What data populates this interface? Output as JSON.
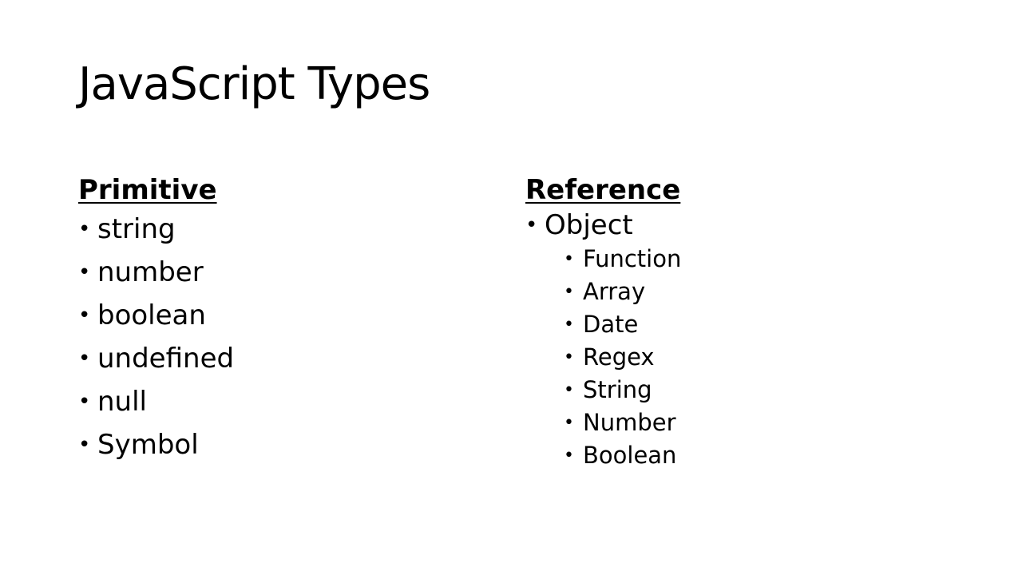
{
  "slide": {
    "title": "JavaScript Types",
    "primitive": {
      "heading": "Primitive",
      "items": [
        "string",
        "number",
        "boolean",
        "undefined",
        "null",
        "Symbol"
      ]
    },
    "reference": {
      "heading": "Reference",
      "item": "Object",
      "subitems": [
        "Function",
        "Array",
        "Date",
        "Regex",
        "String",
        "Number",
        "Boolean"
      ]
    }
  }
}
